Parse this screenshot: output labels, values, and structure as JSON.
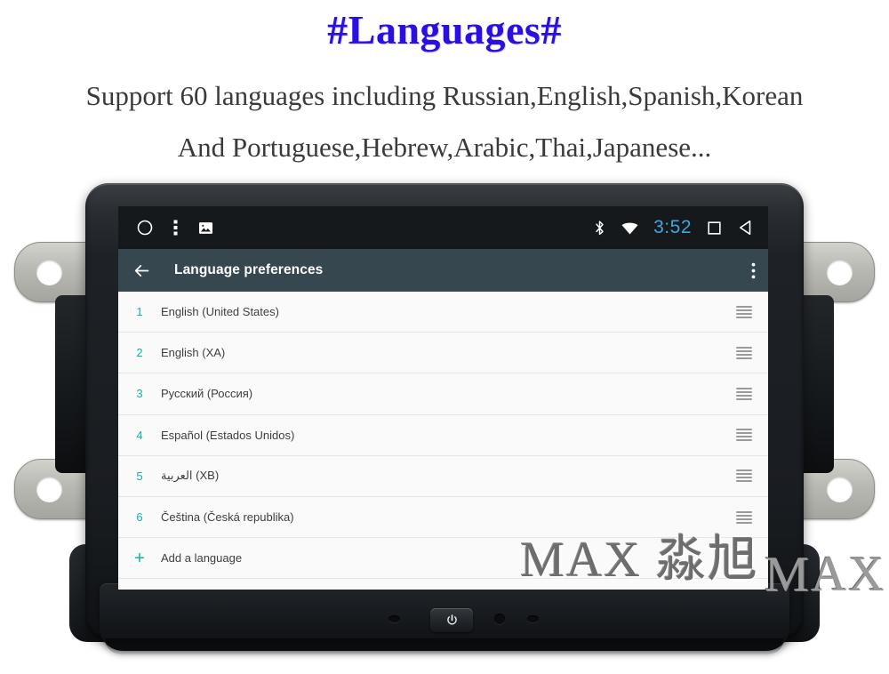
{
  "promo": {
    "title": "#Languages#",
    "subtitle_line1": "Support 60 languages including Russian,English,Spanish,Korean",
    "subtitle_line2": "And Portuguese,Hebrew,Arabic,Thai,Japanese...",
    "title_color": "#2a10e0",
    "subtitle_color": "#3a3a3a"
  },
  "watermark": {
    "text": "MAX 淼旭"
  },
  "device": {
    "power_button_icon": "power-icon"
  },
  "screen": {
    "status_bar": {
      "background": "#15191c",
      "clock": "3:52",
      "clock_color": "#3ba8e0",
      "left_icons": [
        {
          "name": "home-circle-icon"
        },
        {
          "name": "overflow-menu-icon"
        },
        {
          "name": "screenshot-image-icon"
        }
      ],
      "right_icons": [
        {
          "name": "bluetooth-icon"
        },
        {
          "name": "wifi-icon"
        },
        {
          "name": "recents-square-icon"
        },
        {
          "name": "back-triangle-icon"
        }
      ]
    },
    "app_bar": {
      "background": "#37474f",
      "back_icon": "back-arrow-icon",
      "title": "Language preferences",
      "overflow_icon": "overflow-menu-icon"
    },
    "list": {
      "accent_color": "#14b2a0",
      "label_color": "#3c3f42",
      "background": "#fafafa",
      "rows": [
        {
          "index": "1",
          "label": "English (United States)",
          "handle": "drag-handle-icon"
        },
        {
          "index": "2",
          "label": "English (XA)",
          "handle": "drag-handle-icon"
        },
        {
          "index": "3",
          "label": "Русский (Россия)",
          "handle": "drag-handle-icon"
        },
        {
          "index": "4",
          "label": "Español (Estados Unidos)",
          "handle": "drag-handle-icon"
        },
        {
          "index": "5",
          "label": "العربية (XB)",
          "handle": "drag-handle-icon"
        },
        {
          "index": "6",
          "label": "Čeština (Česká republika)",
          "handle": "drag-handle-icon"
        }
      ],
      "add_row": {
        "icon": "plus-icon",
        "icon_glyph": "+",
        "label": "Add a language"
      }
    }
  }
}
